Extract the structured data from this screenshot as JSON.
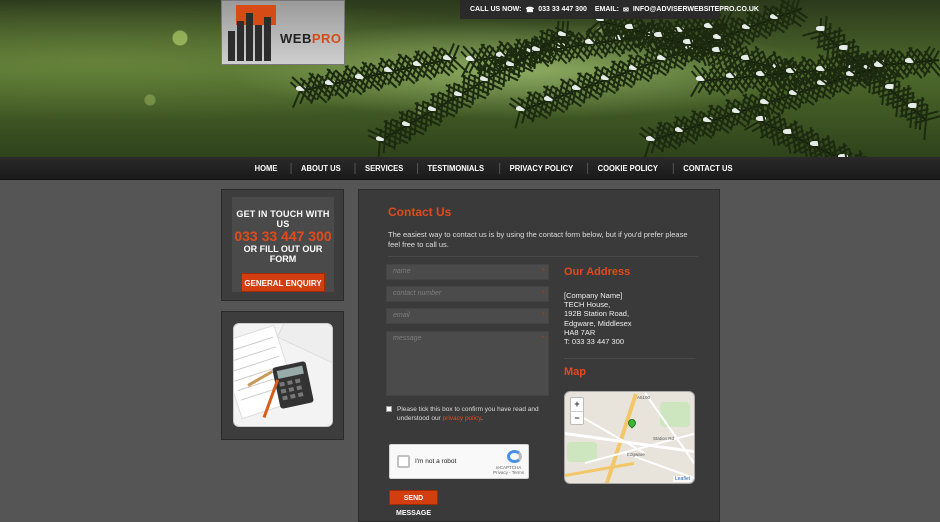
{
  "brand": {
    "logo_word_1": "WEB",
    "logo_word_2": "PRO"
  },
  "topbar": {
    "call_label": "CALL US NOW:",
    "phone": "033 33 447 300",
    "email_label": "EMAIL:",
    "email": "INFO@ADVISERWEBSITEPRO.CO.UK"
  },
  "nav": {
    "items": [
      "HOME",
      "ABOUT US",
      "SERVICES",
      "TESTIMONIALS",
      "PRIVACY POLICY",
      "COOKIE POLICY",
      "CONTACT US"
    ]
  },
  "sidebar": {
    "line1": "GET IN TOUCH WITH US",
    "phone": "033 33 447 300",
    "line3": "OR FILL OUT OUR FORM",
    "button": "GENERAL ENQUIRY"
  },
  "main": {
    "title": "Contact Us",
    "intro": "The easiest way to contact us is by using the contact form below, but if you'd prefer please feel free to call us.",
    "form": {
      "name_placeholder": "name",
      "contact_placeholder": "contact number",
      "email_placeholder": "email",
      "message_placeholder": "message",
      "required_mark": "*",
      "consent_text": "Please tick this box to confirm you have read and understood our ",
      "consent_link": "privacy policy",
      "consent_end": ".",
      "captcha_label": "I'm not a robot",
      "captcha_brand": "reCAPTCHA",
      "captcha_links": "Privacy - Terms",
      "submit": "SEND MESSAGE"
    },
    "address": {
      "heading": "Our Address",
      "lines": [
        "[Company Name]",
        "TECH House,",
        "192B Station Road,",
        "Edgware, Middlesex",
        "HA8 7AR",
        "T: 033 33 447 300"
      ]
    },
    "map": {
      "heading": "Map",
      "zoom_in": "+",
      "zoom_out": "−",
      "attribution": "Leaflet",
      "labels": [
        "A5100",
        "Edgware",
        "Station Rd"
      ]
    }
  },
  "colors": {
    "accent": "#e24a1c",
    "button": "#d23e10",
    "panel": "#3a3a3a",
    "page": "#555555"
  }
}
